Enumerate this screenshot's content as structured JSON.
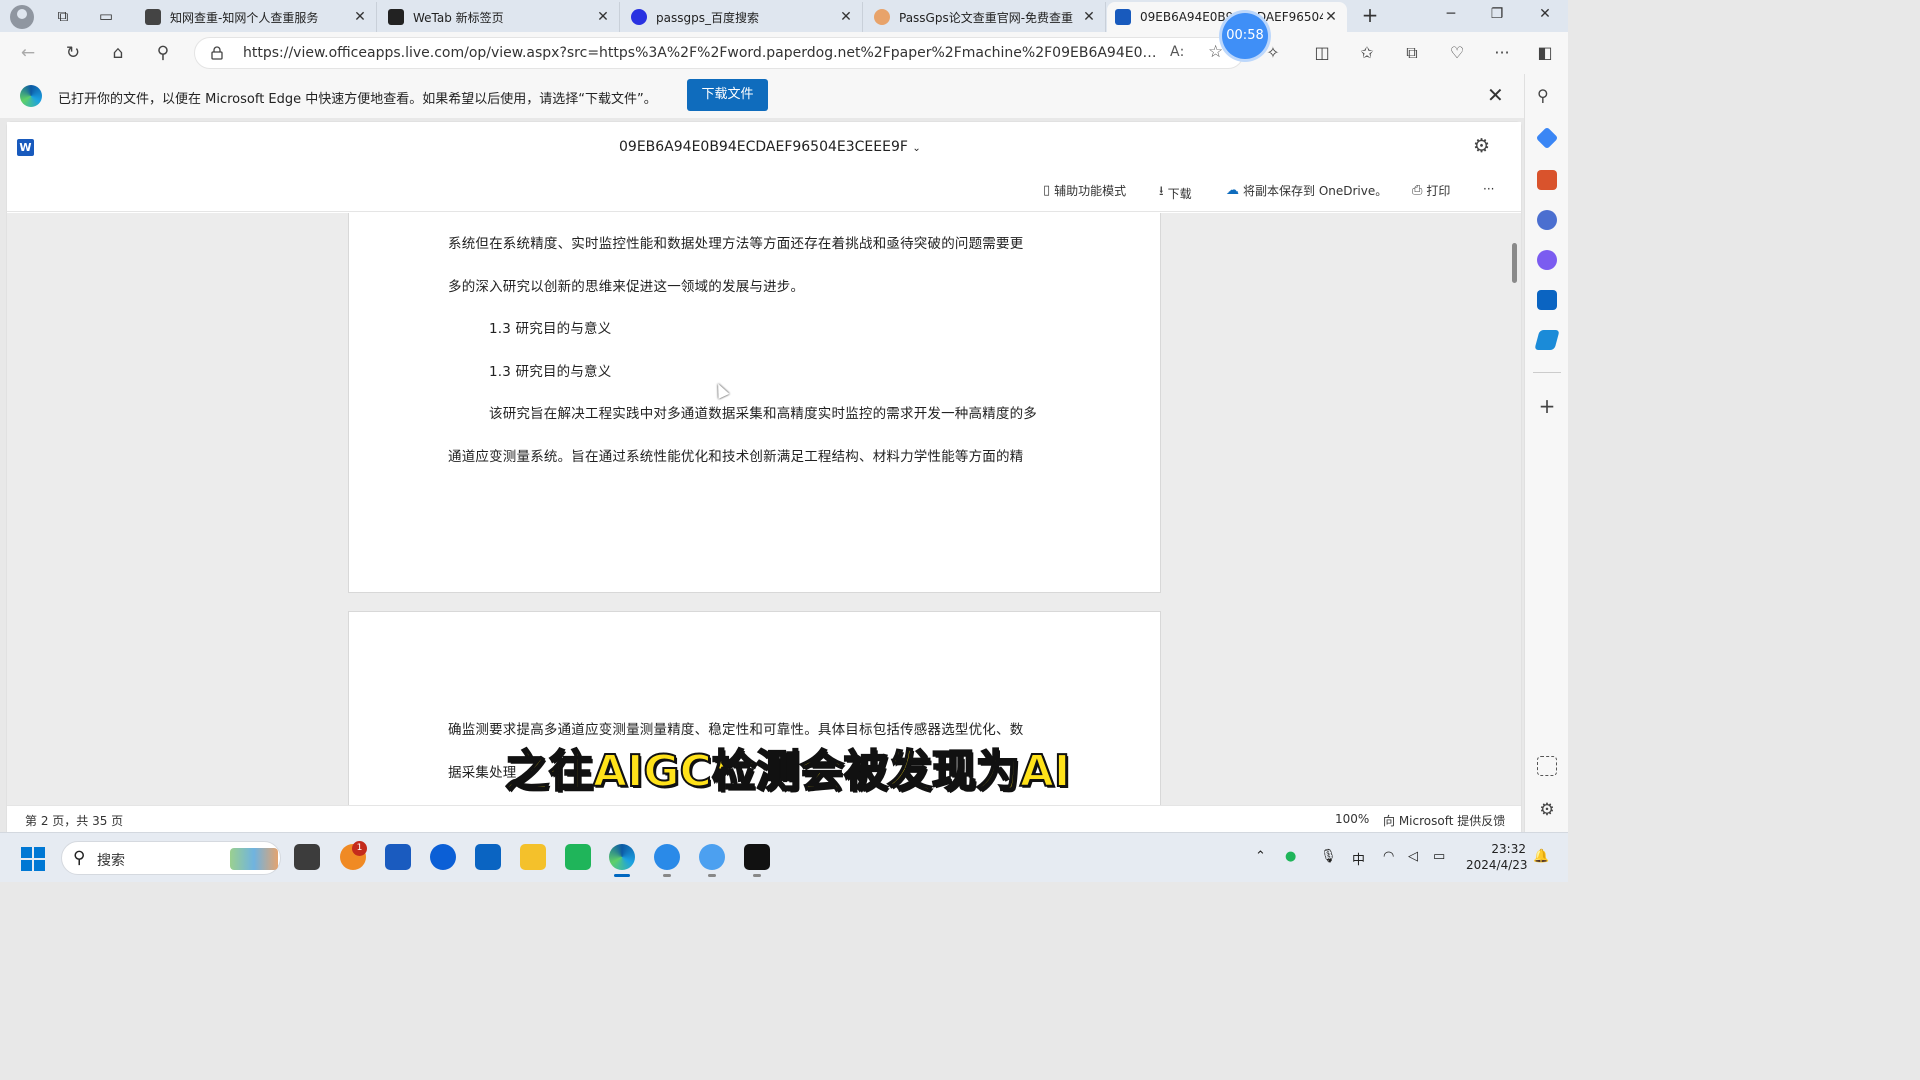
{
  "tabs": [
    {
      "title": "知网查重-知网个人查重服务",
      "color": "#444444"
    },
    {
      "title": "WeTab 新标签页",
      "color": "#222222"
    },
    {
      "title": "passgps_百度搜索",
      "color": "#2932e1"
    },
    {
      "title": "PassGps论文查重官网-免费查重",
      "color": "#e8a36a"
    },
    {
      "title": "09EB6A94E0B94ECDAEF96504E3",
      "color": "#185abd"
    }
  ],
  "address": {
    "url": "https://view.officeapps.live.com/op/view.aspx?src=https%3A%2F%2Fword.paperdog.net%2Fpaper%2Fmachine%2F09EB6A94E0B94ECDAEF9650..."
  },
  "timer": "00:58",
  "infobar": {
    "message": "已打开你的文件，以便在 Microsoft Edge 中快速方便地查看。如果希望以后使用，请选择“下载文件”。",
    "download_button": "下载文件"
  },
  "viewer": {
    "doc_title": "09EB6A94E0B94ECDAEF96504E3CEEE9F",
    "commands": {
      "accessibility": "辅助功能模式",
      "download": "下载",
      "save_onedrive": "将副本保存到 OneDrive。",
      "print": "打印",
      "more": "···"
    }
  },
  "document": {
    "page1_lines": [
      "系统但在系统精度、实时监控性能和数据处理方法等方面还存在着挑战和亟待突破的问题需要更",
      "多的深入研究以创新的思维来促进这一领域的发展与进步。",
      "1.3 研究目的与意义",
      "1.3 研究目的与意义",
      "该研究旨在解决工程实践中对多通道数据采集和高精度实时监控的需求开发一种高精度的多",
      "通道应变测量系统。旨在通过系统性能优化和技术创新满足工程结构、材料力学性能等方面的精"
    ],
    "page2_lines": [
      "确监测要求提高多通道应变测量测量精度、稳定性和可靠性。具体目标包括传感器选型优化、数",
      "据采集处理"
    ]
  },
  "status": {
    "page_info": "第 2 页，共 35 页",
    "zoom": "100%",
    "feedback": "向 Microsoft 提供反馈"
  },
  "subtitle": "之往AIGC检测会被发现为AI",
  "taskbar": {
    "search_placeholder": "搜索",
    "badge_count": "1",
    "ime": "中",
    "time": "23:32",
    "date": "2024/4/23"
  },
  "colors": {
    "accent": "#0f6cbd",
    "word_blue": "#185abd",
    "subtitle_yellow": "#ffe21a"
  }
}
